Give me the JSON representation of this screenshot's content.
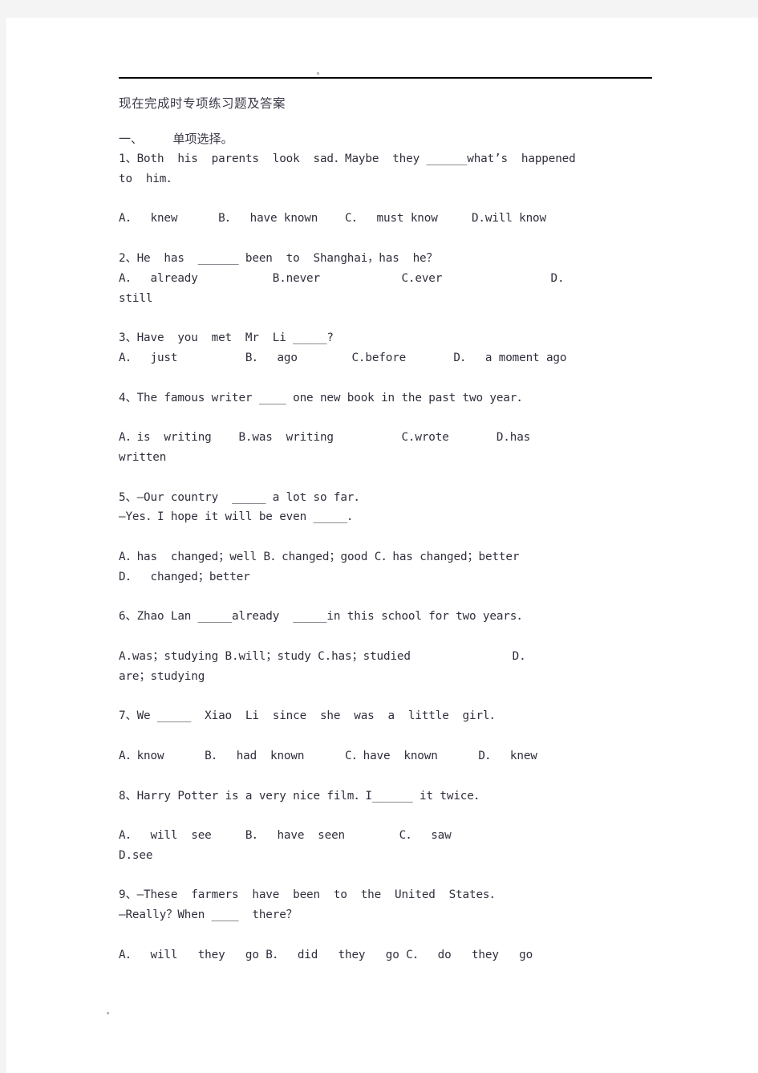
{
  "document": {
    "title": "现在完成时专项练习题及答案",
    "section_heading": "一、　　　单项选择。",
    "header_rule": true
  },
  "questions": [
    {
      "number": "1",
      "stem": "1、Both  his  parents  look  sad．Maybe  they ______what’s  happened\nto  him．",
      "options": "A．  knew      B．  have known    C．  must know     D.will know"
    },
    {
      "number": "2",
      "stem": "2、He  has  ______ been  to  Shanghai，has  he？",
      "options": "A．  already           B.never            C.ever                D.\nstill"
    },
    {
      "number": "3",
      "stem": "3、Have  you  met  Mr  Li _____?",
      "options": "A．  just          B．  ago        C.before       D．  a moment ago"
    },
    {
      "number": "4",
      "stem": "4、The famous writer ____ one new book in the past two year．",
      "options": "A．is  writing    B.was  writing          C.wrote       D.has\nwritten"
    },
    {
      "number": "5",
      "stem": "5、—Our country  _____ a lot so far．\n—Yes．I hope it will be even _____．",
      "options": "A．has  changed；well B．changed；good C．has changed；better\nD．  changed；better"
    },
    {
      "number": "6",
      "stem": "6、Zhao Lan _____already  _____in this school for two years．",
      "options": "A.was；studying B.will；study C.has；studied               D.\nare；studying"
    },
    {
      "number": "7",
      "stem": "7、We _____  Xiao  Li  since  she  was  a  little  girl．",
      "options": "A．know      B．  had  known      C．have  known      D．  knew"
    },
    {
      "number": "8",
      "stem": "8、Harry Potter is a very nice film．I______ it twice．",
      "options": "A．  will  see     B．  have  seen        C．  saw\nD.see"
    },
    {
      "number": "9",
      "stem": "9、—These  farmers  have  been  to  the  United  States．\n—Really？When ____  there？",
      "options": "A．  will   they   go B．  did   they   go C．  do   they   go"
    }
  ],
  "colors": {
    "page_background": "#ffffff",
    "gutter": "#f4f4f4",
    "rule": "#000000",
    "title_text": "#3b3b4a",
    "body_text": "#2f2f3d"
  }
}
